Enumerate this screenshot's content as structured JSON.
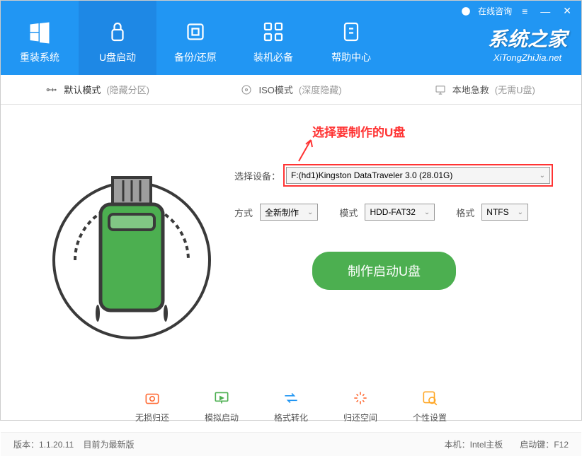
{
  "titlebar": {
    "consult": "在线咨询"
  },
  "nav": {
    "items": [
      {
        "label": "重装系统"
      },
      {
        "label": "U盘启动"
      },
      {
        "label": "备份/还原"
      },
      {
        "label": "装机必备"
      },
      {
        "label": "帮助中心"
      }
    ]
  },
  "logo": {
    "main": "系统之家",
    "sub": "XiTongZhiJia.net"
  },
  "subtabs": {
    "items": [
      {
        "label": "默认模式",
        "suffix": "(隐藏分区)"
      },
      {
        "label": "ISO模式",
        "suffix": "(深度隐藏)"
      },
      {
        "label": "本地急救",
        "suffix": "(无需U盘)"
      }
    ]
  },
  "annotation": "选择要制作的U盘",
  "form": {
    "device_label": "选择设备：",
    "device_value": "F:(hd1)Kingston DataTraveler 3.0 (28.01G)",
    "method_label": "方式",
    "method_value": "全新制作",
    "mode_label": "模式",
    "mode_value": "HDD-FAT32",
    "format_label": "格式",
    "format_value": "NTFS"
  },
  "create_button": "制作启动U盘",
  "actions": {
    "items": [
      {
        "label": "无损归还"
      },
      {
        "label": "模拟启动"
      },
      {
        "label": "格式转化"
      },
      {
        "label": "归还空间"
      },
      {
        "label": "个性设置"
      }
    ]
  },
  "status": {
    "version_label": "版本：",
    "version": "1.1.20.11",
    "latest": "目前为最新版",
    "host_label": "本机：",
    "host": "Intel主板",
    "bootkey_label": "启动键：",
    "bootkey": "F12"
  }
}
